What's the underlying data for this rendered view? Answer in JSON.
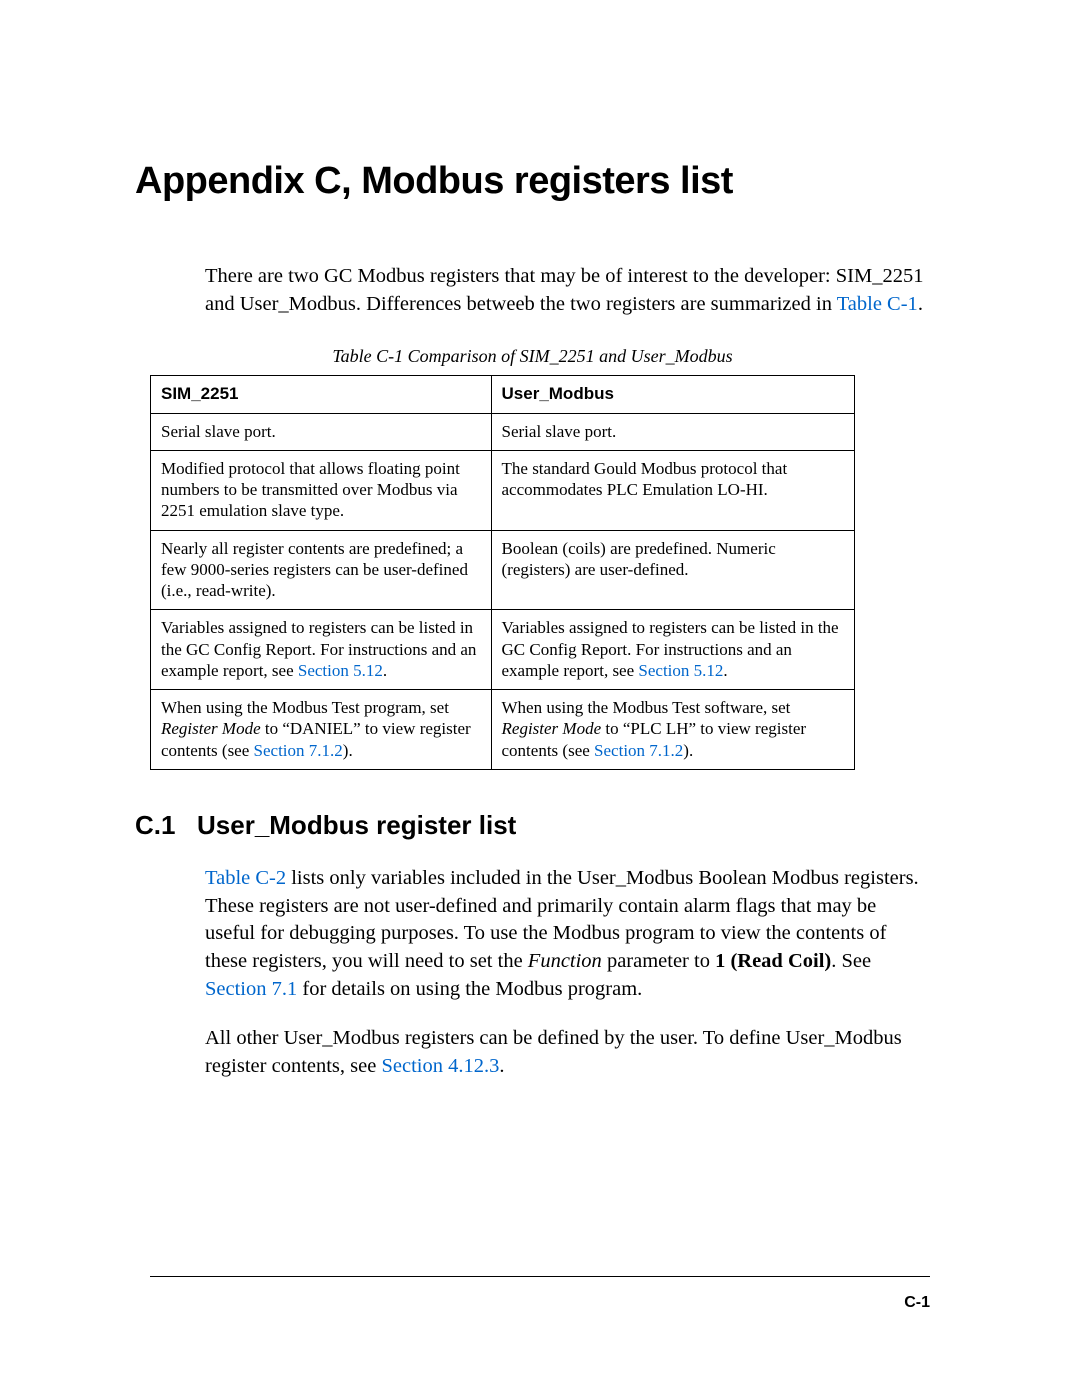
{
  "title": "Appendix C, Modbus registers list",
  "intro": {
    "text_a": "There are two GC Modbus registers that may be of interest to the developer: SIM_2251 and User_Modbus. Differences betweeb the two registers are summarized in ",
    "link": "Table C-1",
    "text_b": "."
  },
  "table_caption": "Table C-1  Comparison of SIM_2251 and User_Modbus",
  "table": {
    "headers": [
      "SIM_2251",
      "User_Modbus"
    ],
    "rows": [
      {
        "c1": "Serial slave port.",
        "c2": "Serial slave port."
      },
      {
        "c1": "Modified protocol that allows floating point numbers to be transmitted over Modbus via 2251 emulation slave type.",
        "c2": "The standard Gould Modbus protocol that accommodates PLC Emulation LO-HI."
      },
      {
        "c1": "Nearly all register contents are predefined; a few 9000-series registers can be user-defined (i.e., read-write).",
        "c2": "Boolean (coils) are predefined. Numeric (registers) are user-defined."
      },
      {
        "c1_a": "Variables assigned to registers can be listed in the GC Config Report.  For instructions and an example report, see ",
        "c1_link": "Section 5.12",
        "c1_b": ".",
        "c2_a": "Variables assigned to registers can be listed in the GC Config Report.  For instructions and an example report, see ",
        "c2_link": "Section 5.12",
        "c2_b": "."
      },
      {
        "c1_a": "When using the Modbus Test program, set ",
        "c1_i": "Register Mode",
        "c1_b": " to “DANIEL” to view register contents (see ",
        "c1_link": "Section 7.1.2",
        "c1_c": ").",
        "c2_a": "When using the Modbus Test software, set ",
        "c2_i": "Register Mode",
        "c2_b": " to “PLC LH” to view register contents (see ",
        "c2_link": "Section 7.1.2",
        "c2_c": ")."
      }
    ]
  },
  "section": {
    "num": "C.1",
    "title": "User_Modbus register list",
    "para1": {
      "link1": "Table C-2",
      "t1": " lists only variables included in the User_Modbus Boolean Modbus registers. These registers are not user-defined and primarily contain alarm flags that may be useful for debugging purposes. To use the Modbus program to view the contents of these registers, you will need to set the ",
      "i1": "Function",
      "t2": " parameter to ",
      "b1": "1 (Read Coil)",
      "t3": ". See ",
      "link2": "Section 7.1",
      "t4": " for details on using the Modbus program."
    },
    "para2": {
      "t1": "All other User_Modbus registers can be defined by the user. To define User_Modbus register contents, see ",
      "link1": "Section 4.12.3",
      "t2": "."
    }
  },
  "page_number": "C-1"
}
